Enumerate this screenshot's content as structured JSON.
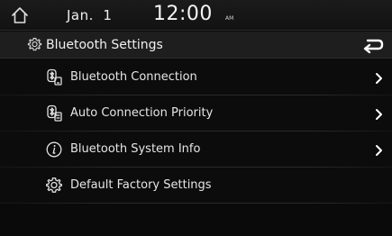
{
  "status_bar": {
    "home_icon": "home-icon",
    "date": "Jan.  1",
    "time": "12:00",
    "ampm": "AM"
  },
  "header": {
    "title": "Bluetooth Settings",
    "icon": "gear-icon",
    "back_icon": "back-arrow-icon"
  },
  "menu": {
    "items": [
      {
        "label": "Bluetooth Connection",
        "icon": "bluetooth-phone-icon",
        "has_chevron": true
      },
      {
        "label": "Auto Connection Priority",
        "icon": "bluetooth-priority-icon",
        "has_chevron": true
      },
      {
        "label": "Bluetooth System Info",
        "icon": "info-icon",
        "has_chevron": true
      },
      {
        "label": "Default Factory Settings",
        "icon": "gear-icon",
        "has_chevron": false
      }
    ]
  },
  "colors": {
    "background": "#0a0a0a",
    "text": "#e6e6e6",
    "bar": "#1e1e1e"
  }
}
